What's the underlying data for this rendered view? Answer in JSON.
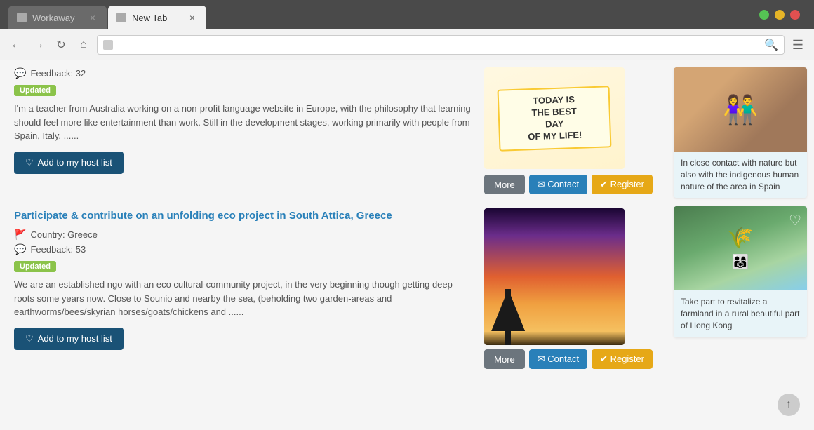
{
  "browser": {
    "tabs": [
      {
        "label": "Workaway",
        "active": false
      },
      {
        "label": "New Tab",
        "active": true
      }
    ],
    "traffic_lights": [
      "green",
      "yellow",
      "red"
    ]
  },
  "nav": {
    "back": "‹",
    "forward": "›",
    "refresh": "↻",
    "home": "⌂",
    "search_placeholder": "",
    "menu": "☰"
  },
  "listings": [
    {
      "id": "listing-1",
      "feedback_icon": "💬",
      "feedback_label": "Feedback: 32",
      "badge": "Updated",
      "description": "I'm a teacher from Australia working on a non-profit language website in Europe, with the philosophy that learning should feel more like entertainment than work. Still in the development stages, working primarily with people from Spain, Italy, ......",
      "add_btn": "Add to my host list",
      "heart_icon": "♡",
      "action_btns": {
        "more": "More",
        "contact": "✉ Contact",
        "register": "✔ Register"
      }
    },
    {
      "id": "listing-2",
      "title": "Participate & contribute on an unfolding eco project in South Attica, Greece",
      "flag_icon": "🚩",
      "country_label": "Country: Greece",
      "feedback_icon": "💬",
      "feedback_label": "Feedback: 53",
      "badge": "Updated",
      "description": "We are an established ngo with an eco cultural-community project, in the very beginning though getting deep roots some years now. Close to Sounio and nearby the sea, (beholding two garden-areas and earthworms/bees/skyrian horses/goats/chickens and ......",
      "add_btn": "Add to my host list",
      "heart_icon": "♡",
      "action_btns": {
        "more": "More",
        "contact": "✉ Contact",
        "register": "✔ Register"
      }
    }
  ],
  "sidebar": {
    "card1": {
      "description": "In close contact with nature but also with the indigenous human nature of the area in Spain"
    },
    "card2": {
      "description": "Take part to revitalize a farmland in a rural beautiful part of Hong Kong",
      "heart_icon": "♡"
    }
  },
  "scroll_top": "↑"
}
